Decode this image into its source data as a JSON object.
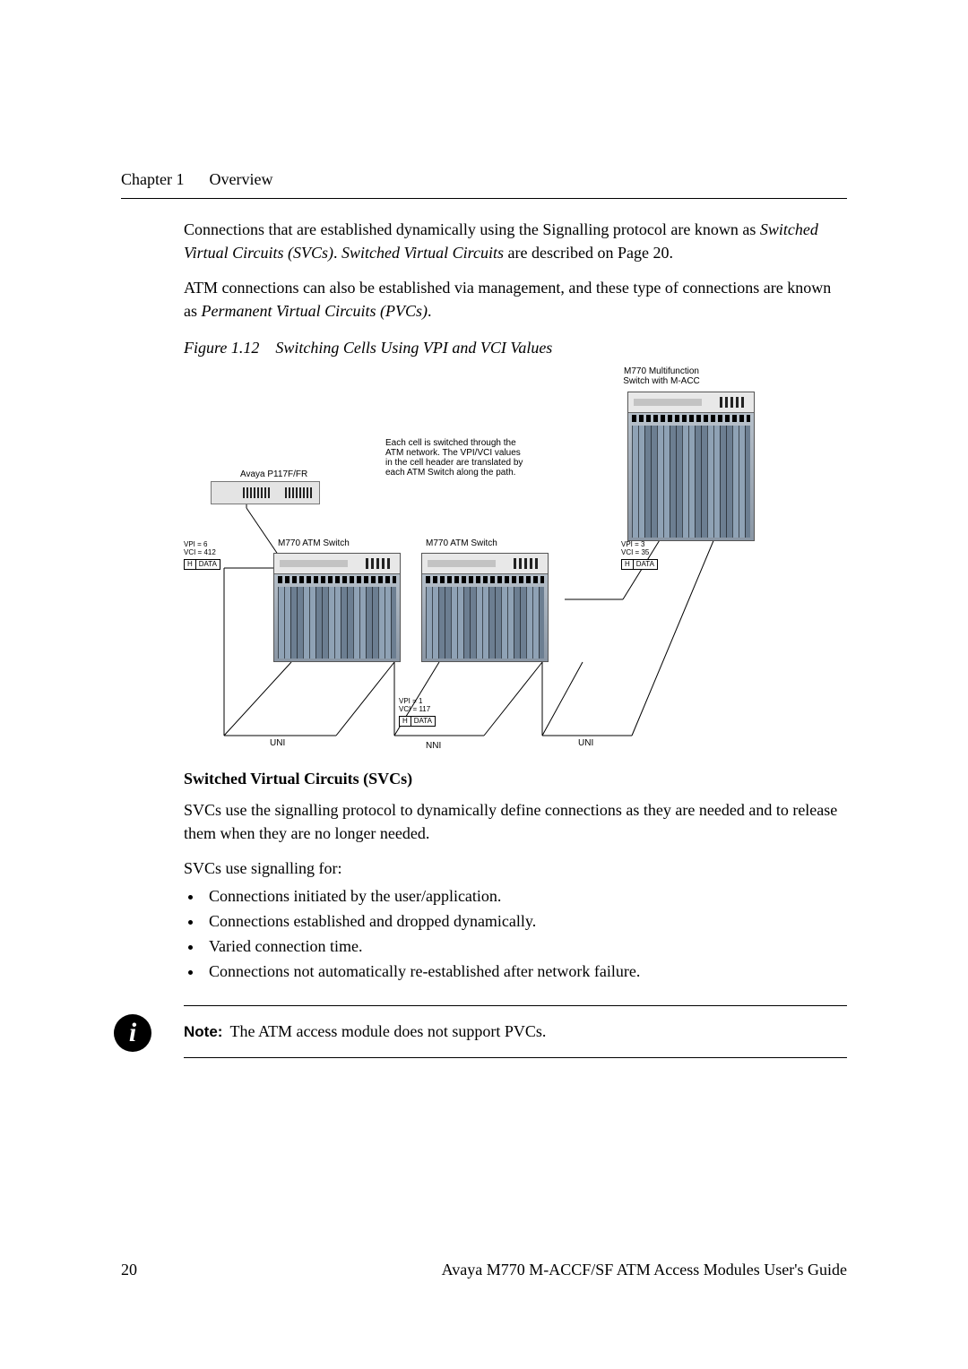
{
  "header": {
    "chapter": "Chapter 1",
    "title": "Overview"
  },
  "para1_a": "Connections that are established dynamically using the Signalling protocol are known as ",
  "para1_b": "Switched Virtual Circuits (SVCs)",
  "para1_c": ". ",
  "para1_d": "Switched Virtual Circuits",
  "para1_e": " are described on Page 20.",
  "para2_a": "ATM connections can also be established via management, and these type of connections are known as ",
  "para2_b": "Permanent Virtual Circuits (PVCs)",
  "para2_c": ".",
  "figure_caption_pre": "Figure 1.12",
  "figure_caption_txt": "Switching Cells Using VPI and VCI Values",
  "figure": {
    "top_right_label_1": "M770 Multifunction",
    "top_right_label_2": "Switch with M-ACC",
    "desc_line1": "Each cell is switched through the",
    "desc_line2": "ATM network. The VPI/VCI values",
    "desc_line3": "in the cell header are translated by",
    "desc_line4": "each ATM Switch along the path.",
    "avaya_label": "Avaya P117F/FR",
    "sw1_label": "M770 ATM Switch",
    "sw2_label": "M770 ATM Switch",
    "vpi_left_1": "VPI = 6",
    "vpi_left_2": "VCI = 412",
    "vpi_right_1": "VPI = 3",
    "vpi_right_2": "VCI = 35",
    "vpi_mid_1": "VPI = 1",
    "vpi_mid_2": "VCI = 117",
    "h": "H",
    "data": "DATA",
    "uni": "UNI",
    "nni": "NNI"
  },
  "section_heading": "Switched Virtual Circuits (SVCs)",
  "section_p1": "SVCs use the signalling protocol to dynamically define connections as they are needed and to release them when they are no longer needed.",
  "section_p2": "SVCs use signalling for:",
  "bullets": {
    "b1": "Connections initiated by the user/application.",
    "b2": "Connections established and dropped dynamically.",
    "b3": "Varied connection time.",
    "b4": "Connections not automatically re-established after network failure."
  },
  "note_label": "Note:",
  "note_text": "The ATM access module does not support PVCs.",
  "footer": {
    "page": "20",
    "doc": "Avaya M770 M-ACCF/SF ATM Access Modules User's Guide"
  }
}
